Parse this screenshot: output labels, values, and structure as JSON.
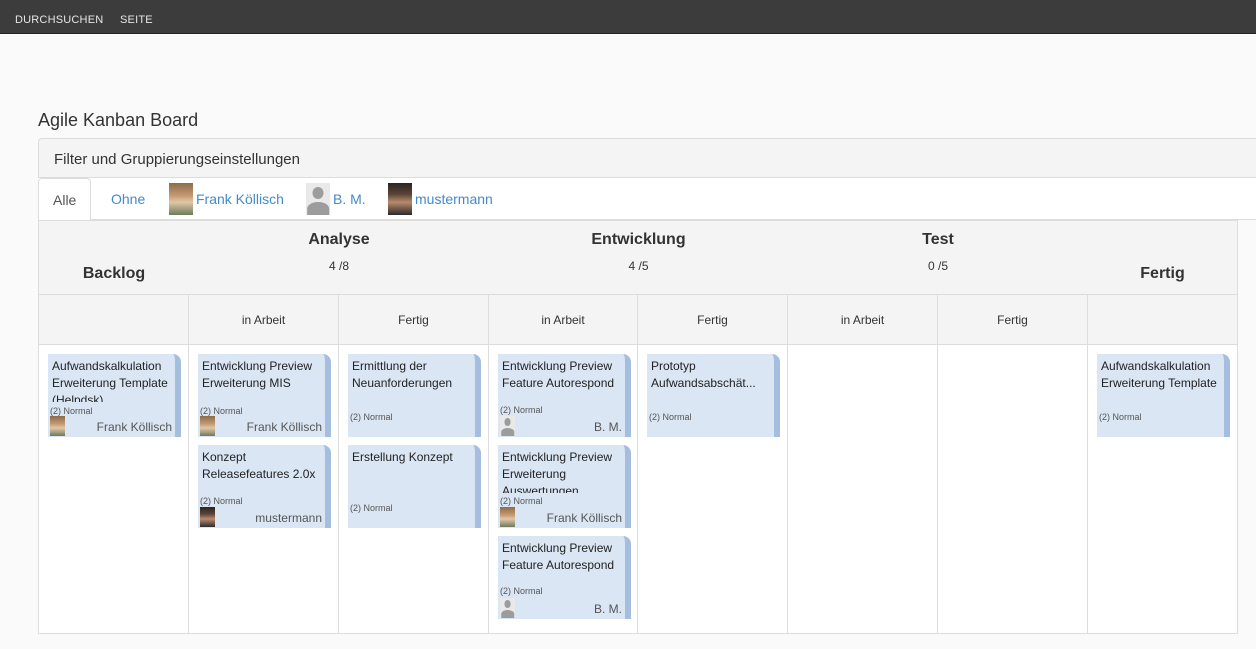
{
  "ribbon": {
    "tabs": [
      "DURCHSUCHEN",
      "SEITE"
    ]
  },
  "page_title": "Agile Kanban Board",
  "filter": {
    "label": "Filter und Gruppierungseinstellungen"
  },
  "tabs": [
    {
      "label": "Alle",
      "active": true
    },
    {
      "label": "Ohne",
      "active": false
    },
    {
      "label": "Frank Köllisch",
      "avatar": "photo-a"
    },
    {
      "label": "B. M.",
      "avatar": "generic"
    },
    {
      "label": "mustermann",
      "avatar": "photo-b"
    }
  ],
  "board": {
    "groups": [
      {
        "title": "Backlog"
      },
      {
        "title": "Analyse",
        "count": "4 /8"
      },
      {
        "title": "Entwicklung",
        "count": "4 /5"
      },
      {
        "title": "Test",
        "count": "0 /5"
      },
      {
        "title": "Fertig"
      }
    ],
    "subcolumns": [
      "",
      "in Arbeit",
      "Fertig",
      "in Arbeit",
      "Fertig",
      "in Arbeit",
      "Fertig",
      ""
    ]
  },
  "cards": {
    "backlog_1": {
      "title": "Aufwandskalkulation Erweiterung Template (Helpdsk)",
      "priority": "(2) Normal",
      "user": "Frank Köllisch"
    },
    "analyse_arbeit_1": {
      "title": "Entwicklung Preview Erweiterung MIS",
      "priority": "(2) Normal",
      "user": "Frank Köllisch"
    },
    "analyse_arbeit_2": {
      "title": "Konzept Releasefeatures 2.0x",
      "priority": "(2) Normal",
      "user": "mustermann"
    },
    "analyse_fertig_1": {
      "title": "Ermittlung der Neuanforderungen",
      "priority": "(2) Normal"
    },
    "analyse_fertig_2": {
      "title": "Erstellung Konzept",
      "priority": "(2) Normal"
    },
    "entw_arbeit_1": {
      "title": "Entwicklung Preview Feature Autorespond",
      "priority": "(2) Normal",
      "user": "B. M."
    },
    "entw_arbeit_2": {
      "title": "Entwicklung Preview Erweiterung Auswertungen",
      "priority": "(2) Normal",
      "user": "Frank Köllisch"
    },
    "entw_arbeit_3": {
      "title": "Entwicklung Preview Feature Autorespond",
      "priority": "(2) Normal",
      "user": "B. M."
    },
    "entw_fertig_1": {
      "title": "Prototyp Aufwandsabschät...",
      "priority": "(2) Normal"
    },
    "fertig_1": {
      "title": "Aufwandskalkulation Erweiterung Template",
      "priority": "(2) Normal"
    }
  },
  "colors": {
    "ribbon_bg": "#3c3c3c",
    "link": "#428bca",
    "card_bg": "#dae6f4",
    "card_accent": "#a5bedf"
  }
}
